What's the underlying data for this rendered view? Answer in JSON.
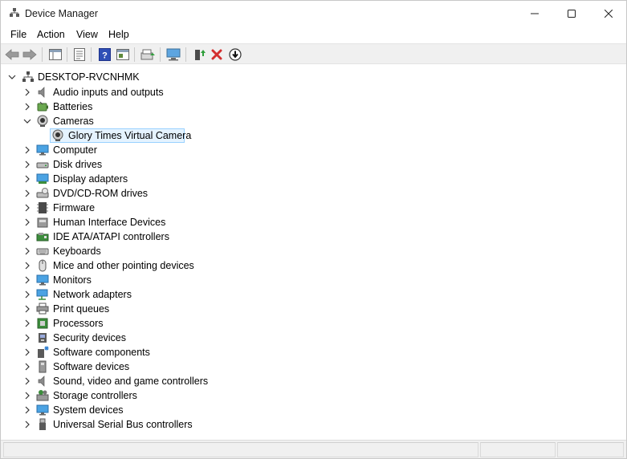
{
  "window": {
    "title": "Device Manager"
  },
  "menu": [
    "File",
    "Action",
    "View",
    "Help"
  ],
  "toolbar": {
    "buttons": [
      "back-icon",
      "forward-icon",
      "show-hide-console-tree-icon",
      "properties-icon",
      "help-icon",
      "view-icon",
      "update-driver-icon",
      "scan-hardware-icon",
      "enable-device-icon",
      "uninstall-device-icon",
      "disable-device-icon"
    ]
  },
  "tree": {
    "root": {
      "label": "DESKTOP-RVCNHMK",
      "expanded": true
    },
    "categories": [
      {
        "label": "Audio inputs and outputs",
        "icon": "speaker-icon"
      },
      {
        "label": "Batteries",
        "icon": "battery-icon"
      },
      {
        "label": "Cameras",
        "icon": "camera-icon",
        "expanded": true,
        "children": [
          {
            "label": "Glory Times Virtual Camera",
            "icon": "camera-icon",
            "selected": true
          }
        ]
      },
      {
        "label": "Computer",
        "icon": "computer-icon"
      },
      {
        "label": "Disk drives",
        "icon": "disk-drive-icon"
      },
      {
        "label": "Display adapters",
        "icon": "display-adapter-icon"
      },
      {
        "label": "DVD/CD-ROM drives",
        "icon": "dvd-drive-icon"
      },
      {
        "label": "Firmware",
        "icon": "firmware-icon"
      },
      {
        "label": "Human Interface Devices",
        "icon": "hid-icon"
      },
      {
        "label": "IDE ATA/ATAPI controllers",
        "icon": "ide-controller-icon"
      },
      {
        "label": "Keyboards",
        "icon": "keyboard-icon"
      },
      {
        "label": "Mice and other pointing devices",
        "icon": "mouse-icon"
      },
      {
        "label": "Monitors",
        "icon": "monitor-icon"
      },
      {
        "label": "Network adapters",
        "icon": "network-adapter-icon"
      },
      {
        "label": "Print queues",
        "icon": "printer-icon"
      },
      {
        "label": "Processors",
        "icon": "processor-icon"
      },
      {
        "label": "Security devices",
        "icon": "security-device-icon"
      },
      {
        "label": "Software components",
        "icon": "software-component-icon"
      },
      {
        "label": "Software devices",
        "icon": "software-device-icon"
      },
      {
        "label": "Sound, video and game controllers",
        "icon": "sound-controller-icon"
      },
      {
        "label": "Storage controllers",
        "icon": "storage-controller-icon"
      },
      {
        "label": "System devices",
        "icon": "system-device-icon"
      },
      {
        "label": "Universal Serial Bus controllers",
        "icon": "usb-icon"
      }
    ]
  },
  "colors": {
    "selection_fill": "#e5f3ff",
    "selection_border": "#99d1ff",
    "uninstall_red": "#d32f2f"
  }
}
